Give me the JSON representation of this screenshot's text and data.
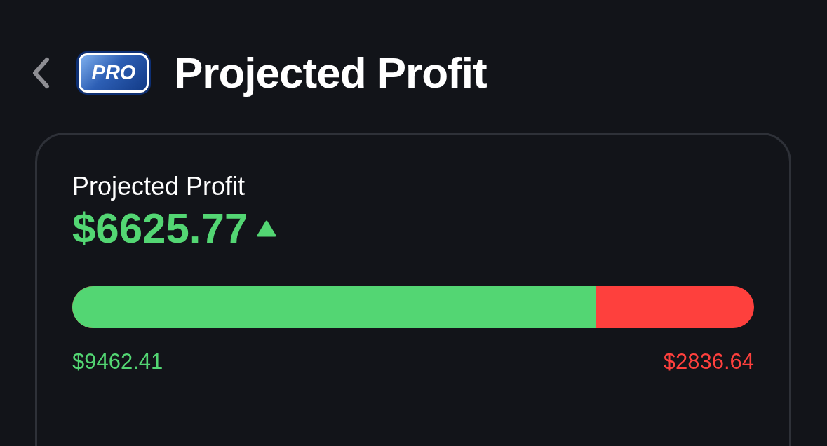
{
  "header": {
    "badge": "PRO",
    "title": "Projected Profit"
  },
  "card": {
    "label": "Projected Profit",
    "value": "$6625.77",
    "trending_up": true,
    "bar": {
      "level": 0.769
    },
    "left_amount": "$9462.41",
    "right_amount": "$2836.64"
  }
}
